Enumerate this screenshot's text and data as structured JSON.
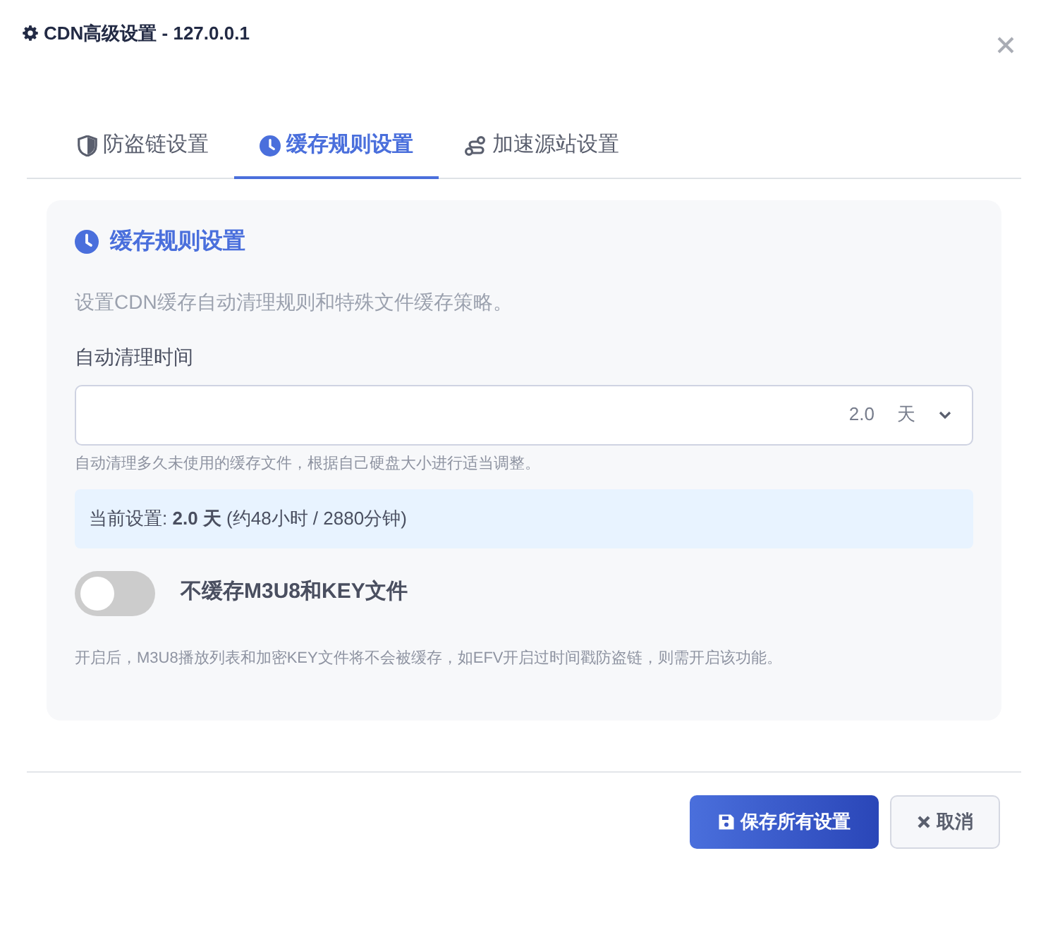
{
  "window": {
    "title": "CDN高级设置 - 127.0.0.1"
  },
  "tabs": [
    {
      "label": "防盗链设置",
      "selected": false
    },
    {
      "label": "缓存规则设置",
      "selected": true
    },
    {
      "label": "加速源站设置",
      "selected": false
    }
  ],
  "panel": {
    "title": "缓存规则设置",
    "description": "设置CDN缓存自动清理规则和特殊文件缓存策略。",
    "field": {
      "label": "自动清理时间",
      "value": "2.0",
      "unit": "天",
      "help": "自动清理多久未使用的缓存文件，根据自己硬盘大小进行适当调整。"
    },
    "current": "当前设置: **2.0 天** (约48小时 / 2880分钟)",
    "toggle": {
      "label": "不缓存M3U8和KEY文件",
      "on": false,
      "help": "开启后，M3U8播放列表和加密KEY文件将不会被缓存，如EFV开启过时间戳防盗链，则需开启该功能。"
    }
  },
  "buttons": [
    {
      "kind": "primary",
      "label": "保存所有设置"
    },
    {
      "kind": "cancel",
      "label": "取消"
    }
  ]
}
